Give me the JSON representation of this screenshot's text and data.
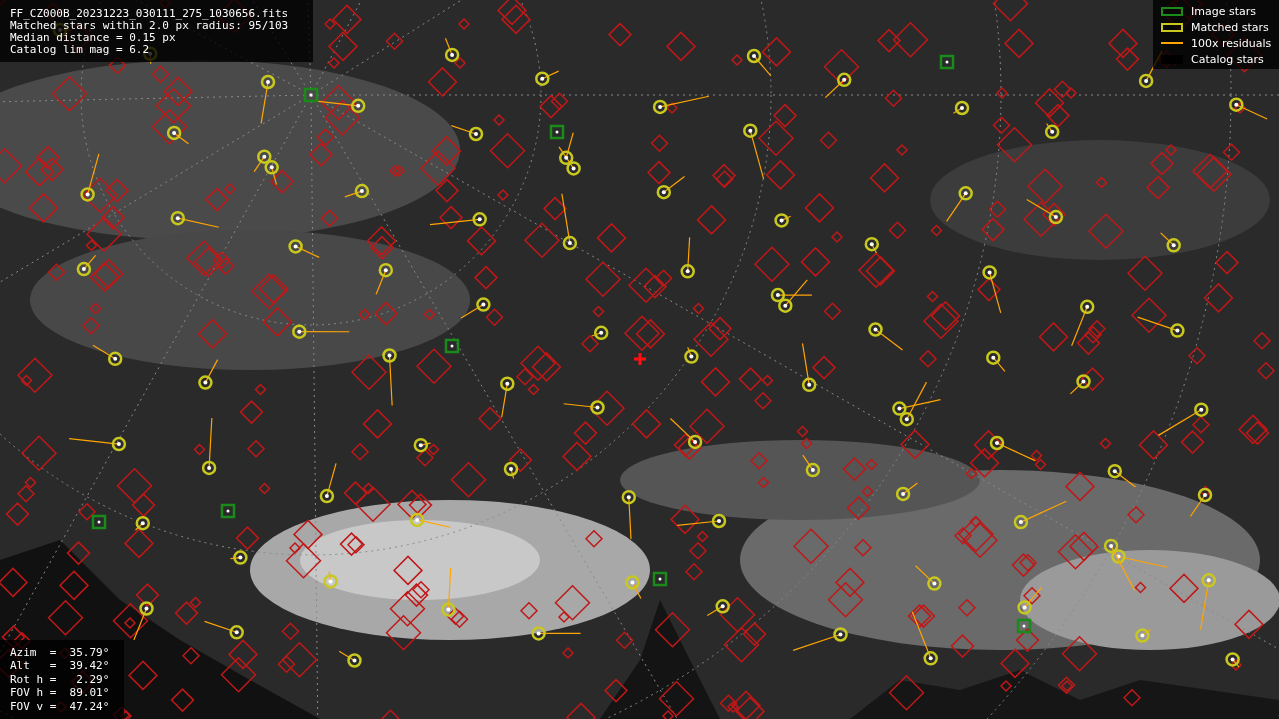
{
  "info": [
    "FF_CZ000B_20231223_030111_275_1030656.fits",
    "Matched stars within 2.0 px radius: 95/103",
    "Median distance = 0.15 px",
    "Catalog lim mag = 6.2"
  ],
  "legend": [
    {
      "label": "Image stars",
      "color": "#1a8a1a"
    },
    {
      "kind": "matched",
      "label": "Matched stars",
      "color": "#c8c81e"
    },
    {
      "kind": "residual",
      "label": "100x residuals",
      "color": "#ffa500"
    },
    {
      "kind": "catalog",
      "label": "Catalog stars",
      "color": "#000000"
    }
  ],
  "pointing": [
    "Azim  =  35.79°",
    "Alt   =  39.42°",
    "Rot h =   2.29°",
    "FOV h =  89.01°",
    "FOV v =  47.24°"
  ]
}
